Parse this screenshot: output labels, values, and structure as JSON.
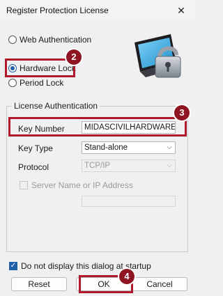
{
  "window": {
    "title": "Register Protection License",
    "close_glyph": "✕"
  },
  "auth_options": [
    {
      "label": "Web Authentication",
      "selected": false
    },
    {
      "label": "Hardware Lock",
      "selected": true
    },
    {
      "label": "Period Lock",
      "selected": false
    }
  ],
  "badges": [
    "2",
    "3",
    "4"
  ],
  "license": {
    "group_title": "License Authentication",
    "key_number_label": "Key Number",
    "key_number_value": "MIDASCIVILHARDWARE",
    "key_type_label": "Key Type",
    "key_type_value": "Stand-alone",
    "protocol_label": "Protocol",
    "protocol_value": "TCP/IP",
    "server_label": "Server Name or IP Address",
    "server_value": ""
  },
  "footer": {
    "dont_display_label": "Do not display this dialog at startup",
    "dont_display_checked": true,
    "reset_label": "Reset",
    "ok_label": "OK",
    "cancel_label": "Cancel"
  },
  "icons": {
    "illustration": "computer-padlock-icon",
    "dropdown": "chevron-down-icon"
  },
  "colors": {
    "highlight": "#b2182b",
    "badge": "#8f1422",
    "accent": "#1f5fa8"
  }
}
